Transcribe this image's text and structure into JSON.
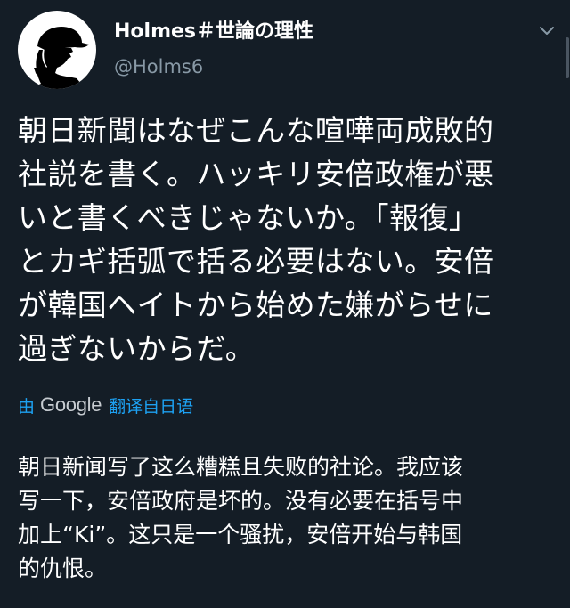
{
  "author": {
    "display_name": "Holmes＃世論の理性",
    "handle": "@Holms6"
  },
  "tweet": {
    "text": "朝日新聞はなぜこんな喧嘩両成敗的\n社説を書く。ハッキリ安倍政権が悪\nいと書くべきじゃないか。「報復」\nとカギ括弧で括る必要はない。安倍\nが韓国ヘイトから始めた嫌がらせに\n過ぎないからだ。"
  },
  "translation": {
    "by": "由",
    "provider": "Google",
    "link": "翻译自日语",
    "text": "朝日新闻写了这么糟糕且失败的社论。我应该\n写一下，安倍政府是坏的。没有必要在括号中\n加上“Ki”。这只是一个骚扰，安倍开始与韩国\n的仇恨。"
  },
  "colors": {
    "background": "#141d26",
    "text": "#ffffff",
    "secondary": "#8899a6",
    "link": "#1da1f2"
  },
  "icons": {
    "avatar": "sherlock-holmes-silhouette",
    "menu": "chevron-down-icon"
  }
}
